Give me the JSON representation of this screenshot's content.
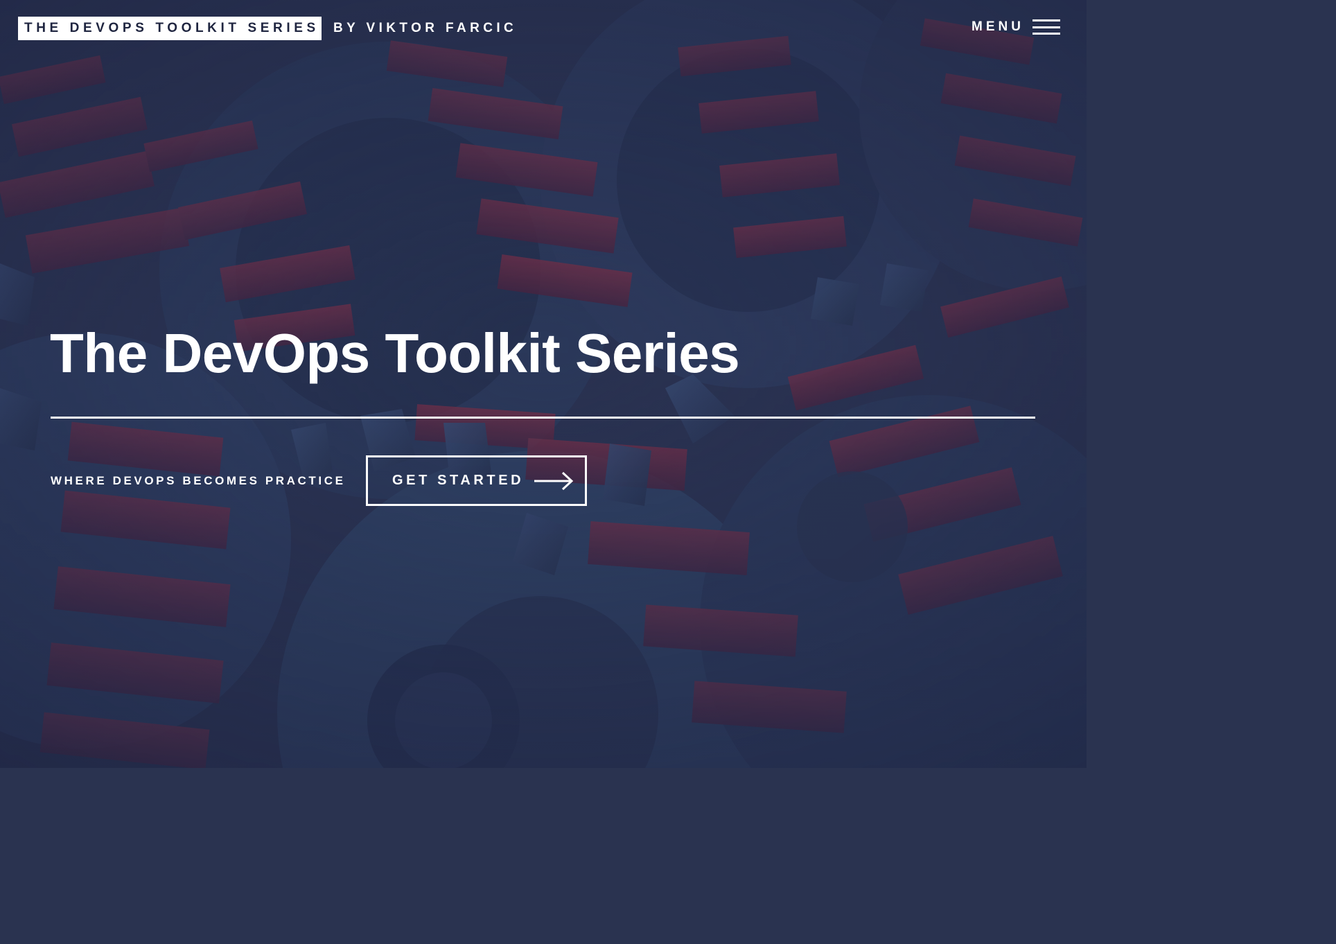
{
  "header": {
    "brand_title": "THE DEVOPS TOOLKIT SERIES",
    "brand_author": "BY VIKTOR FARCIC",
    "menu_label": "MENU",
    "menu_icon": "hamburger-icon"
  },
  "hero": {
    "title": "The DevOps Toolkit Series",
    "tagline": "WHERE DEVOPS BECOMES PRACTICE",
    "cta_label": "GET STARTED",
    "cta_icon": "arrow-right-icon",
    "background_image": "blue-and-red gears photo"
  },
  "colors": {
    "overlay_blue": "#2a3350",
    "gear_red": "#6a2a44",
    "gear_blue": "#33476e",
    "text": "#ffffff",
    "brand_box_text": "#1f2540"
  }
}
